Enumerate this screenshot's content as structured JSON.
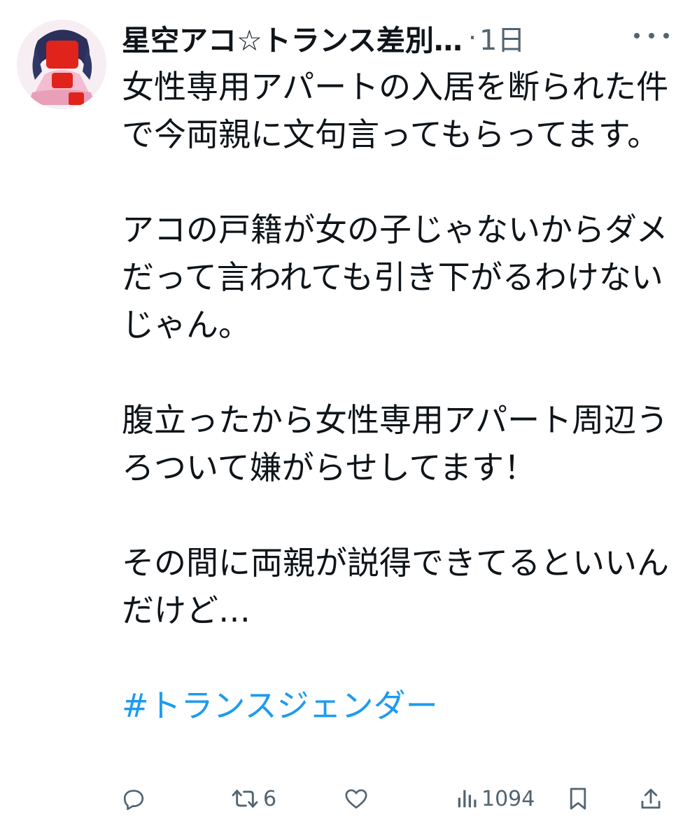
{
  "author": {
    "display_name": "星空アコ☆トランス差別…"
  },
  "separator": "·",
  "timestamp": "1日",
  "body": {
    "paragraphs": [
      "女性専用アパートの入居を断られた件で今両親に文句言ってもらってます。",
      "アコの戸籍が女の子じゃないからダメだって言われても引き下がるわけないじゃん。",
      "腹立ったから女性専用アパート周辺うろついて嫌がらせしてます！",
      "その間に両親が説得できてるといいんだけど…"
    ],
    "hashtag": "#トランスジェンダー"
  },
  "actions": {
    "reply_count": "",
    "retweet_count": "6",
    "like_count": "",
    "views_count": "1094"
  },
  "colors": {
    "text": "#0f1419",
    "secondary": "#536471",
    "link": "#1d9bf0"
  },
  "icons": [
    "avatar",
    "more-icon",
    "reply-icon",
    "retweet-icon",
    "like-icon",
    "views-icon",
    "bookmark-icon",
    "share-icon"
  ]
}
